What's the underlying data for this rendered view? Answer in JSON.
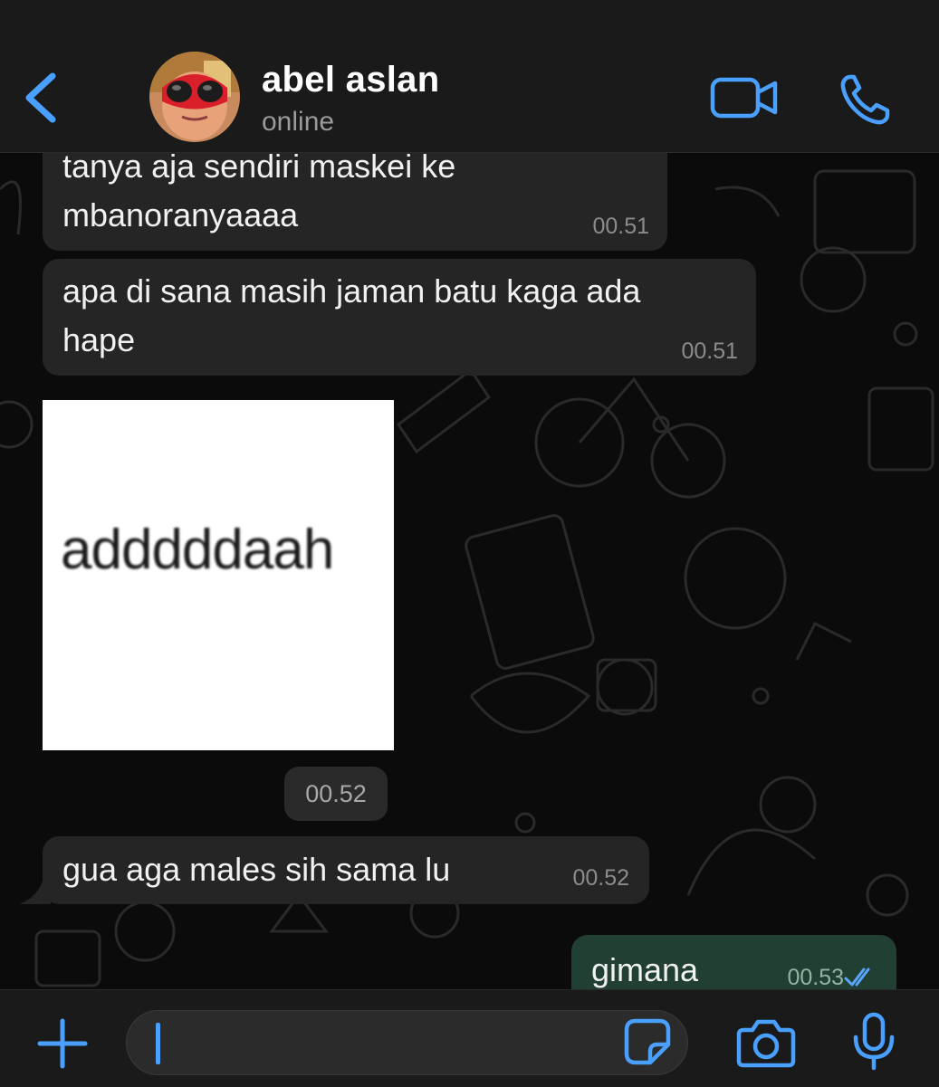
{
  "header": {
    "contact_name": "abel aslan",
    "contact_status": "online",
    "icons": [
      "chevron-left-icon",
      "avatar",
      "video-call-icon",
      "phone-icon"
    ]
  },
  "messages": [
    {
      "direction": "incoming",
      "text": "tanya aja sendiri maskei ke\nmbanoranyaaaa",
      "time": "00.51"
    },
    {
      "direction": "incoming",
      "text": "apa di sana masih jaman batu kaga ada\nhape",
      "time": "00.51"
    },
    {
      "direction": "incoming",
      "type": "sticker",
      "sticker_text": "adddddaah",
      "time": "00.52"
    },
    {
      "direction": "incoming",
      "text": "gua aga males sih sama lu",
      "time": "00.52"
    },
    {
      "direction": "outgoing",
      "text": "gimana",
      "time": "00.53",
      "status": "read"
    }
  ],
  "input_bar": {
    "placeholder": "",
    "icons": [
      "plus-icon",
      "sticker-icon",
      "camera-icon",
      "mic-icon"
    ]
  },
  "colors": {
    "accent": "#4aa0ff",
    "header_bg": "#1a1a1a",
    "incoming_bubble": "#252525",
    "outgoing_bubble": "#214033",
    "chat_bg": "#0b0b0b"
  }
}
